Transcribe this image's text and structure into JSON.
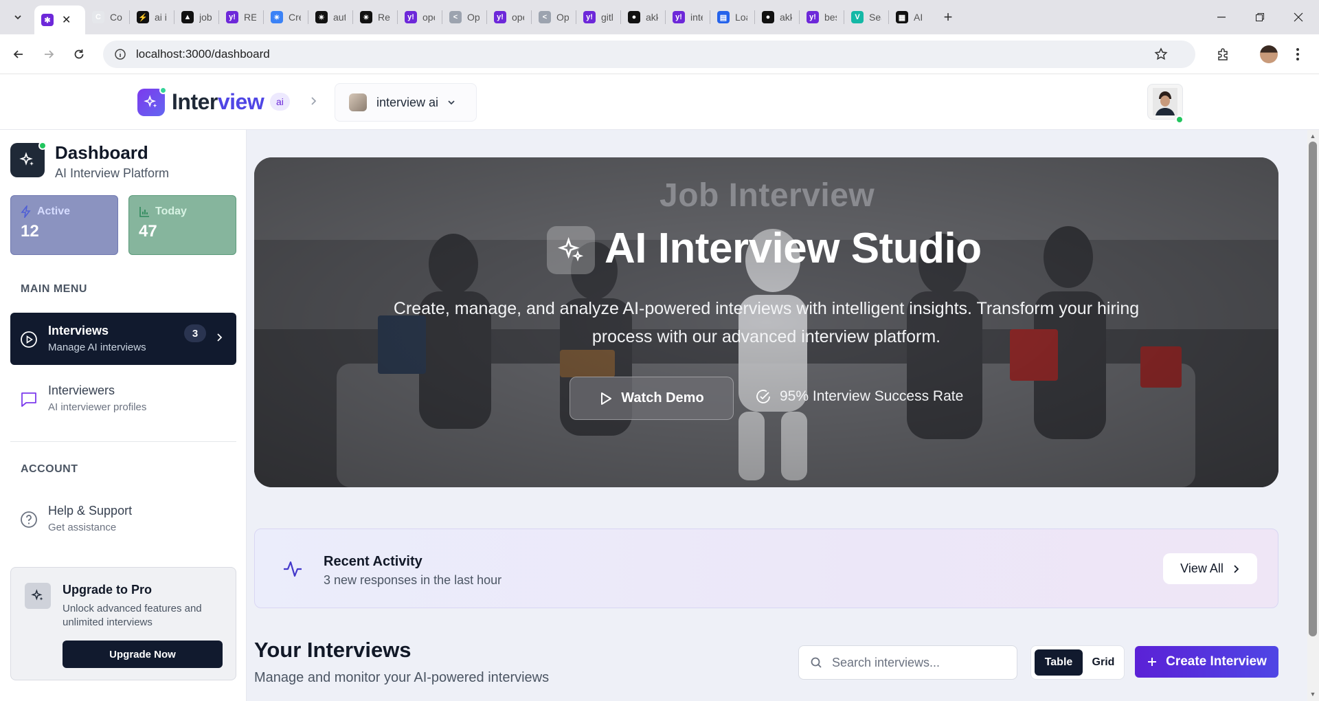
{
  "browser": {
    "tabs": [
      {
        "label": "",
        "color": "#6d28d9",
        "glyph": "✱",
        "active": true
      },
      {
        "label": "Cor",
        "color": "#e5e7eb",
        "glyph": "C"
      },
      {
        "label": "ai i",
        "color": "#111111",
        "glyph": "⚡"
      },
      {
        "label": "job",
        "color": "#111111",
        "glyph": "▲"
      },
      {
        "label": "RET",
        "color": "#6d28d9",
        "glyph": "y!"
      },
      {
        "label": "Cre",
        "color": "#3b82f6",
        "glyph": "✴"
      },
      {
        "label": "aut",
        "color": "#111111",
        "glyph": "✴"
      },
      {
        "label": "Ret",
        "color": "#111111",
        "glyph": "✴"
      },
      {
        "label": "ope",
        "color": "#6d28d9",
        "glyph": "y!"
      },
      {
        "label": "Op",
        "color": "#9ca3af",
        "glyph": "<"
      },
      {
        "label": "ope",
        "color": "#6d28d9",
        "glyph": "y!"
      },
      {
        "label": "Op",
        "color": "#9ca3af",
        "glyph": "<"
      },
      {
        "label": "gitl",
        "color": "#6d28d9",
        "glyph": "y!"
      },
      {
        "label": "akk",
        "color": "#111111",
        "glyph": "●"
      },
      {
        "label": "inte",
        "color": "#6d28d9",
        "glyph": "y!"
      },
      {
        "label": "Loa",
        "color": "#2563eb",
        "glyph": "▤"
      },
      {
        "label": "akk",
        "color": "#111111",
        "glyph": "●"
      },
      {
        "label": "bes",
        "color": "#6d28d9",
        "glyph": "y!"
      },
      {
        "label": "Sea",
        "color": "#14b8a6",
        "glyph": "V"
      },
      {
        "label": "AI I",
        "color": "#111111",
        "glyph": "▦"
      }
    ],
    "url": "localhost:3000/dashboard"
  },
  "header": {
    "logo_part1": "Inter",
    "logo_part2": "view",
    "logo_badge": "ai",
    "workspace_name": "interview ai"
  },
  "sidebar": {
    "title": "Dashboard",
    "subtitle": "AI Interview Platform",
    "stats": [
      {
        "label": "Active",
        "value": "12"
      },
      {
        "label": "Today",
        "value": "47"
      }
    ],
    "main_menu_label": "MAIN MENU",
    "nav": [
      {
        "title": "Interviews",
        "subtitle": "Manage AI interviews",
        "badge": "3"
      },
      {
        "title": "Interviewers",
        "subtitle": "AI interviewer profiles"
      }
    ],
    "account_label": "ACCOUNT",
    "help": {
      "title": "Help & Support",
      "subtitle": "Get assistance"
    },
    "upgrade": {
      "title": "Upgrade to Pro",
      "text": "Unlock advanced features and unlimited interviews",
      "button": "Upgrade Now"
    }
  },
  "hero": {
    "banner": "Job Interview",
    "title": "AI Interview Studio",
    "description": "Create, manage, and analyze AI-powered interviews with intelligent insights. Transform your hiring process with our advanced interview platform.",
    "watch_demo": "Watch Demo",
    "success_rate": "95% Interview Success Rate"
  },
  "activity": {
    "title": "Recent Activity",
    "subtitle": "3 new responses in the last hour",
    "view_all": "View All"
  },
  "interviews": {
    "title": "Your Interviews",
    "subtitle": "Manage and monitor your AI-powered interviews",
    "search_placeholder": "Search interviews...",
    "view_table": "Table",
    "view_grid": "Grid",
    "create_button": "Create Interview"
  },
  "colors": {
    "brand": "#4f46e5",
    "dark": "#111a2e",
    "online": "#22c55e"
  }
}
